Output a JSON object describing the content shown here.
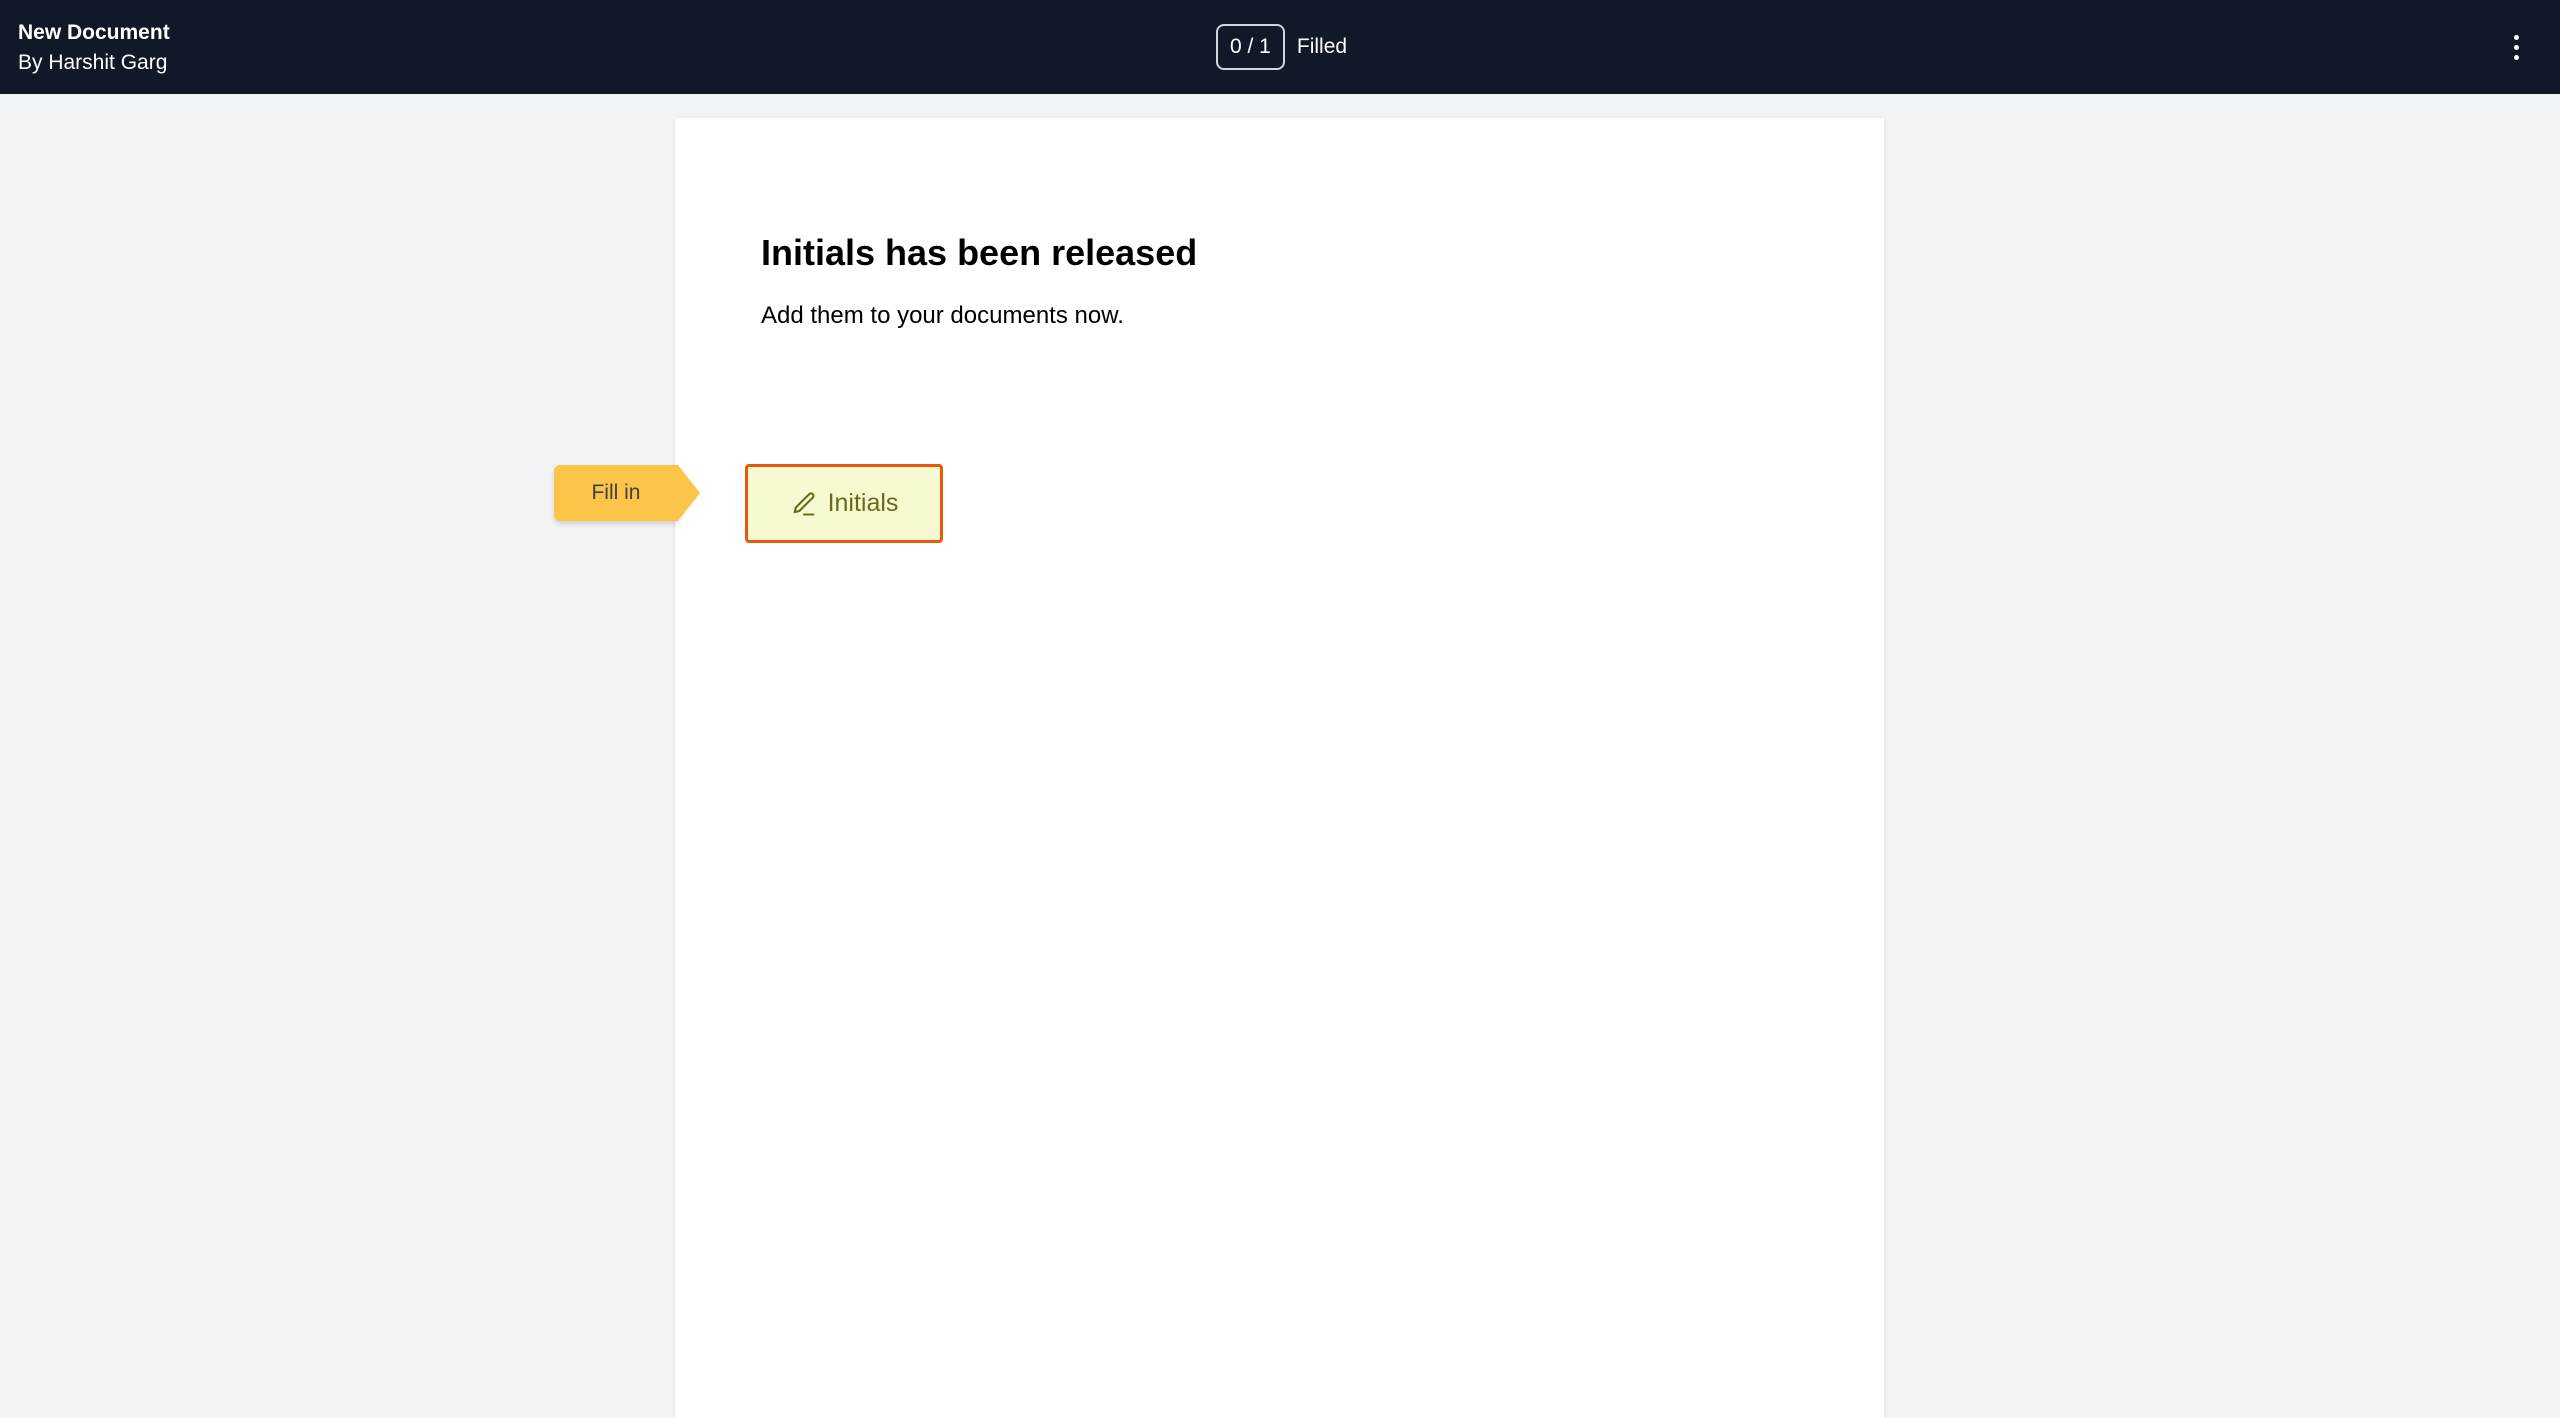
{
  "header": {
    "document_title": "New Document",
    "author": "By Harshit Garg",
    "progress_count": "0 / 1",
    "progress_label": "Filled",
    "menu_icon": "more-vertical-icon"
  },
  "document": {
    "heading": "Initials has been released",
    "body": "Add them to your documents now."
  },
  "field": {
    "fill_tag_label": "Fill in",
    "label": "Initials",
    "icon": "pen-icon",
    "border_color": "#ea580c",
    "background_color": "#f7f9d0",
    "tag_color": "#fcc54a"
  },
  "colors": {
    "topbar": "#111827",
    "canvas": "#f3f4f6",
    "page": "#ffffff"
  }
}
